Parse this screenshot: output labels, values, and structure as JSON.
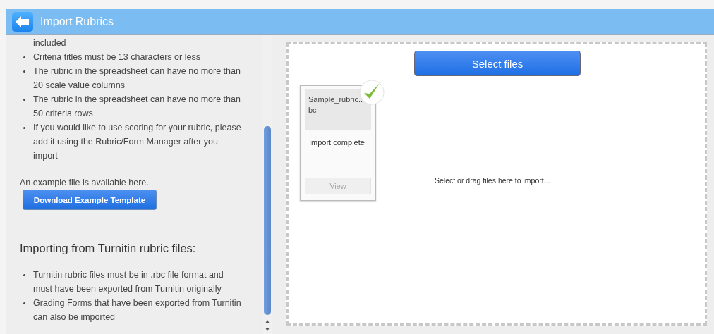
{
  "window": {
    "title": "Import Rubrics"
  },
  "instructions": {
    "items": [
      {
        "kind": "continuation",
        "text": "included"
      },
      {
        "kind": "bullet",
        "text": "Criteria titles must be 13 characters or less"
      },
      {
        "kind": "bullet",
        "text": "The rubric in the spreadsheet can have no more than 20 scale value columns"
      },
      {
        "kind": "bullet",
        "text": "The rubric in the spreadsheet can have no more than 50 criteria rows"
      },
      {
        "kind": "bullet",
        "text": "If you would like to use scoring for your rubric, please add it using the Rubric/Form Manager after you import"
      }
    ],
    "example_note": "An example file is available here.",
    "download_button": "Download Example Template"
  },
  "turnitin": {
    "heading": "Importing from Turnitin rubric files:",
    "items": [
      {
        "kind": "bullet",
        "text": "Turnitin rubric files must be in .rbc file format and must have been exported from Turnitin originally"
      },
      {
        "kind": "bullet",
        "text": "Grading Forms that have been exported from Turnitin can also be imported"
      }
    ]
  },
  "upload": {
    "select_button": "Select files",
    "hint": "Select or drag files here to import...",
    "files": [
      {
        "name": "Sample_rubric..\nbc",
        "status": "Import complete",
        "complete": true,
        "view_button": "View",
        "view_disabled": true
      }
    ]
  }
}
